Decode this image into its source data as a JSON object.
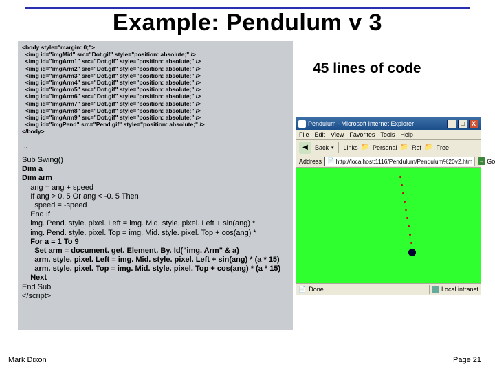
{
  "slide": {
    "title": "Example: Pendulum v 3",
    "footer_left": "Mark Dixon",
    "footer_right_prefix": "Page ",
    "page_number": "21"
  },
  "lines_label": "45 lines of code",
  "code": {
    "html_open": "<body style=\"margin: 0;\">",
    "img_lines": [
      "  <img id=\"imgMid\" src=\"Dot.gif\" style=\"position: absolute;\" />",
      "  <img id=\"imgArm1\" src=\"Dot.gif\" style=\"position: absolute;\" />",
      "  <img id=\"imgArm2\" src=\"Dot.gif\" style=\"position: absolute;\" />",
      "  <img id=\"imgArm3\" src=\"Dot.gif\" style=\"position: absolute;\" />",
      "  <img id=\"imgArm4\" src=\"Dot.gif\" style=\"position: absolute;\" />",
      "  <img id=\"imgArm5\" src=\"Dot.gif\" style=\"position: absolute;\" />",
      "  <img id=\"imgArm6\" src=\"Dot.gif\" style=\"position: absolute;\" />",
      "  <img id=\"imgArm7\" src=\"Dot.gif\" style=\"position: absolute;\" />",
      "  <img id=\"imgArm8\" src=\"Dot.gif\" style=\"position: absolute;\" />",
      "  <img id=\"imgArm9\" src=\"Dot.gif\" style=\"position: absolute;\" />",
      "  <img id=\"imgPend\" src=\"Pend.gif\" style=\"position: absolute;\" />"
    ],
    "html_close": "</body>",
    "ellipsis": "…",
    "sub_lines": [
      "Sub Swing()",
      "Dim a",
      "Dim arm",
      "    ang = ang + speed",
      "    If ang > 0. 5 Or ang < -0. 5 Then",
      "      speed = -speed",
      "    End If",
      "    img. Pend. style. pixel. Left = img. Mid. style. pixel. Left + sin(ang) *",
      "    img. Pend. style. pixel. Top = img. Mid. style. pixel. Top + cos(ang) *",
      "    For a = 1 To 9",
      "      Set arm = document. get. Element. By. Id(\"img. Arm\" & a)",
      "      arm. style. pixel. Left = img. Mid. style. pixel. Left + sin(ang) * (a * 15)",
      "      arm. style. pixel. Top = img. Mid. style. pixel. Top + cos(ang) * (a * 15)",
      "    Next",
      "End Sub",
      "</script>"
    ]
  },
  "browser": {
    "title": "Pendulum - Microsoft Internet Explorer",
    "min": "_",
    "max": "□",
    "close": "X",
    "menu": [
      "File",
      "Edit",
      "View",
      "Favorites",
      "Tools",
      "Help"
    ],
    "toolbar": {
      "back": "Back",
      "links": "Links",
      "personal": "Personal",
      "ref": "Ref",
      "free": "Free"
    },
    "address_label": "Address",
    "address_value": "http://localhost:1116/Pendulum/Pendulum%20v2.htm",
    "go": "Go",
    "status_left": "Done",
    "status_right": "Local intranet"
  }
}
